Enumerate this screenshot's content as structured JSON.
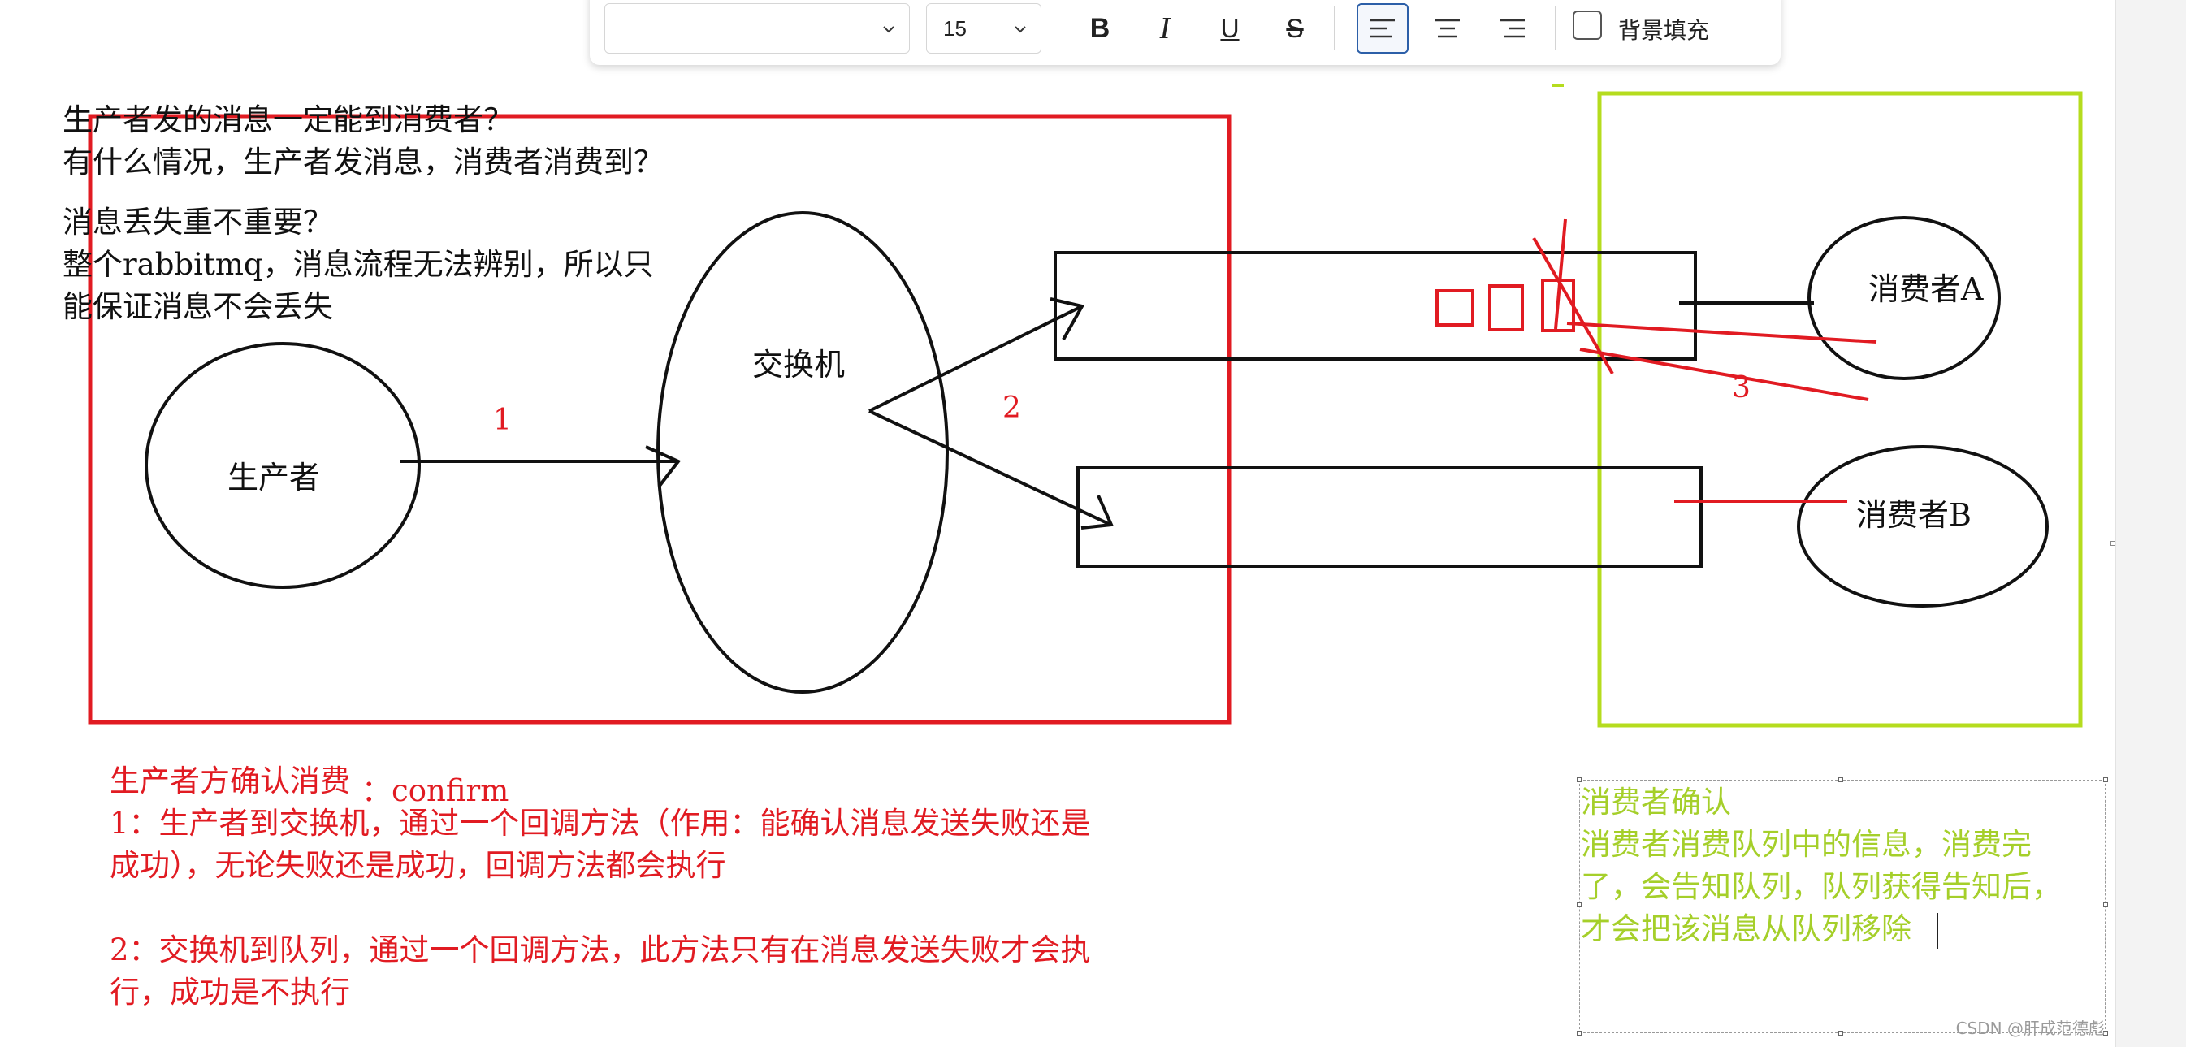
{
  "toolbar": {
    "font_family_value": "",
    "font_size_value": "15",
    "bold_label": "B",
    "italic_label": "I",
    "underline_label": "U",
    "strikethrough_label": "S",
    "align_left_icon": "align-left-icon",
    "align_center_icon": "align-center-icon",
    "align_right_icon": "align-right-icon",
    "background_fill_label": "背景填充",
    "background_fill_checked": false,
    "active_alignment": "left"
  },
  "notes": {
    "question_lines": [
      "生产者发的消息一定能到消费者？",
      "有什么情况，生产者发消息，消费者消费到？"
    ],
    "loss_lines": [
      "消息丢失重不重要？",
      "整个rabbitmq，消息流程无法辨别，所以只",
      "能保证消息不会丢失"
    ],
    "producer_confirm_title": "生产者方确认消费",
    "producer_confirm_keyword": "：confirm",
    "producer_confirm_lines": [
      "1：生产者到交换机，通过一个回调方法（作用：能确认消息发送失败还是",
      "成功），无论失败还是成功，回调方法都会执行",
      "",
      "2：交换机到队列，通过一个回调方法，此方法只有在消息发送失败才会执",
      "行，成功是不执行"
    ],
    "consumer_confirm_lines": [
      "消费者确认",
      "消费者消费队列中的信息，消费完",
      "了，会告知队列，队列获得告知后，",
      "才会把该消息从队列移除"
    ]
  },
  "diagram": {
    "producer_label": "生产者",
    "exchange_label": "交换机",
    "consumer_a_label": "消费者A",
    "consumer_b_label": "消费者B",
    "step_1": "1",
    "step_2": "2",
    "step_3": "3"
  },
  "colors": {
    "red": "#e11b22",
    "green": "#a5cf2a",
    "black": "#111111",
    "accent_blue": "#2c5fa8"
  },
  "watermark": "CSDN @肝成范德彪"
}
